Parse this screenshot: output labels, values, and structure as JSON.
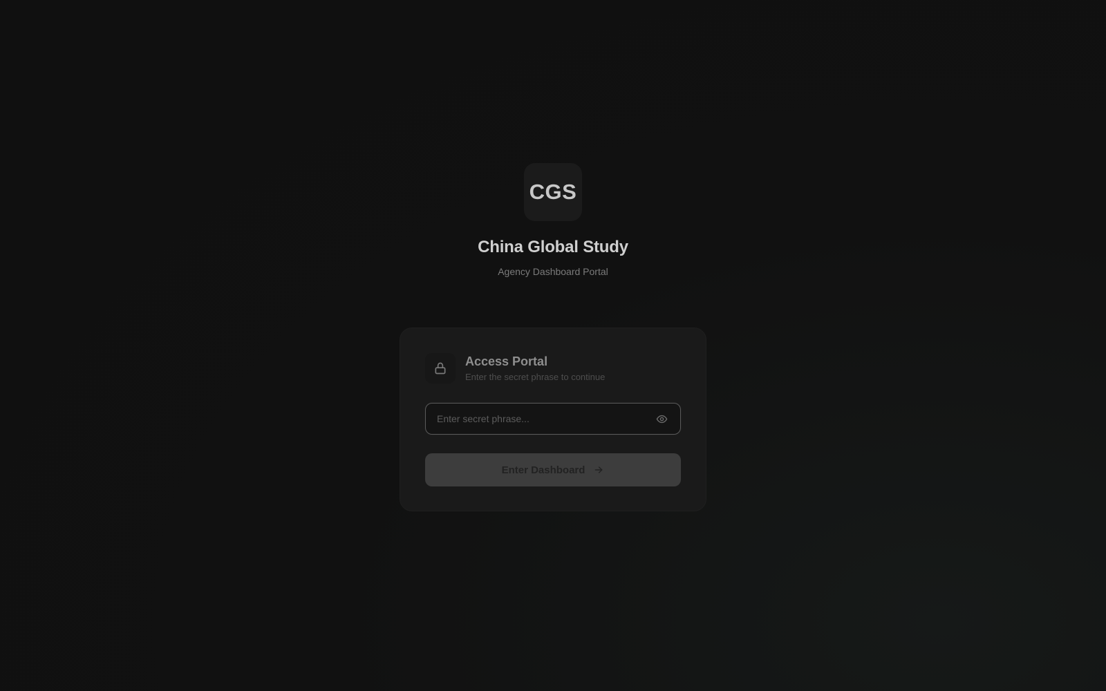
{
  "brand": {
    "logo_text": "CGS",
    "title": "China Global Study",
    "subtitle": "Agency Dashboard Portal"
  },
  "card": {
    "icon": "lock-icon",
    "title": "Access Portal",
    "subtitle": "Enter the secret phrase to continue",
    "input": {
      "placeholder": "Enter secret phrase...",
      "value": "",
      "toggle_icon": "eye-icon"
    },
    "button": {
      "label": "Enter Dashboard",
      "icon": "arrow-right-icon"
    }
  },
  "colors": {
    "background": "#111111",
    "card": "#1a1a1a",
    "button": "#3d3d3d",
    "text_primary": "#cfcfcf",
    "text_muted": "#7b7b7b"
  }
}
